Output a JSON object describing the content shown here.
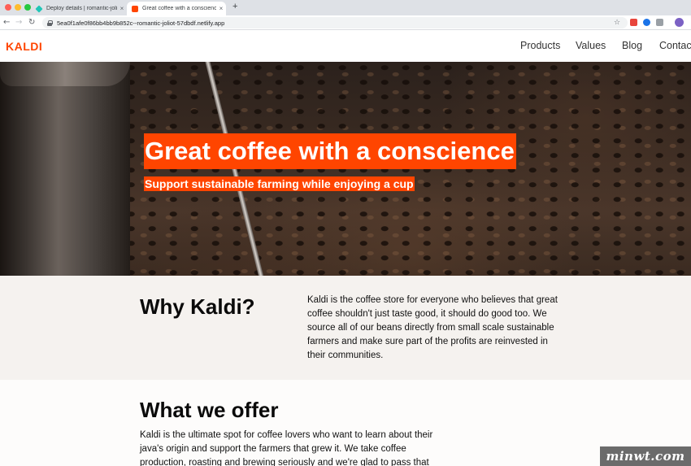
{
  "browser": {
    "tabs": [
      {
        "title": "Deploy details | romantic-jolio",
        "close": "×"
      },
      {
        "title": "Great coffee with a conscience",
        "close": "×"
      }
    ],
    "new_tab": "+",
    "url": "5ea0f1afe0f86bb4bb9b852c--romantic-joliot-57dbdf.netlify.app",
    "icons": [
      "back-icon",
      "forward-icon",
      "reload-icon",
      "lock-icon",
      "star-icon",
      "extension-icon",
      "profile-avatar"
    ]
  },
  "site": {
    "logo": "KALDI",
    "brand_color": "#ff4500",
    "nav": [
      "Products",
      "Values",
      "Blog",
      "Contact"
    ]
  },
  "hero": {
    "title": "Great coffee with a conscience",
    "subtitle": "Support sustainable farming while enjoying a cup"
  },
  "why": {
    "heading": "Why Kaldi?",
    "body": "Kaldi is the coffee store for everyone who believes that great coffee shouldn't just taste good, it should do good too. We source all of our beans directly from small scale sustainable farmers and make sure part of the profits are reinvested in their communities."
  },
  "offer": {
    "heading": "What we offer",
    "body": "Kaldi is the ultimate spot for coffee lovers who want to learn about their java's origin and support the farmers that grew it. We take coffee production, roasting and brewing seriously and we're glad to pass that"
  },
  "watermark": "minwt.com"
}
